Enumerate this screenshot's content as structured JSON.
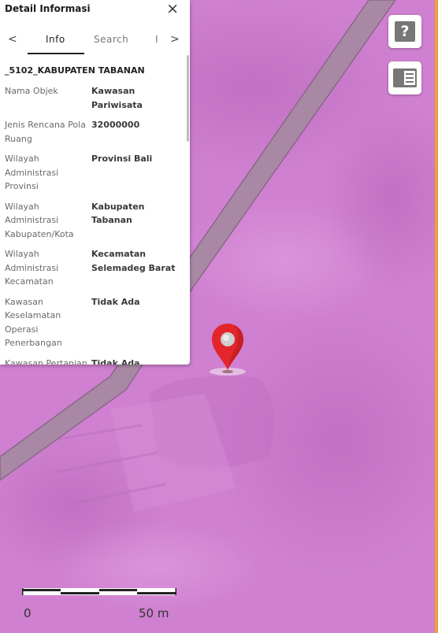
{
  "panel": {
    "title": "Detail Informasi",
    "close_label": "×",
    "tab_prev": "<",
    "tabs": [
      "Info",
      "Search",
      "I"
    ],
    "tab_next": ">",
    "layer_name": "_5102_KABUPATEN TABANAN",
    "rows": [
      {
        "label": "Nama Objek",
        "value": "Kawasan Pariwisata"
      },
      {
        "label": "Jenis Rencana Pola Ruang",
        "value": "32000000"
      },
      {
        "label": "Wilayah Administrasi Provinsi",
        "value": "Provinsi Bali"
      },
      {
        "label": "Wilayah Administrasi Kabupaten/Kota",
        "value": "Kabupaten Tabanan"
      },
      {
        "label": "Wilayah Administrasi Kecamatan",
        "value": "Kecamatan Selemadeg Barat"
      },
      {
        "label": "Kawasan Keselamatan Operasi Penerbangan",
        "value": "Tidak Ada"
      },
      {
        "label": "Kawasan Pertanian",
        "value": "Tidak Ada"
      }
    ]
  },
  "map": {
    "overlay_color": "#cf7fd0",
    "road_color": "#a88aa0",
    "marker_color": "#e3262b",
    "help_label": "?",
    "scale": {
      "start_label": "0",
      "end_label": "50 m"
    }
  }
}
